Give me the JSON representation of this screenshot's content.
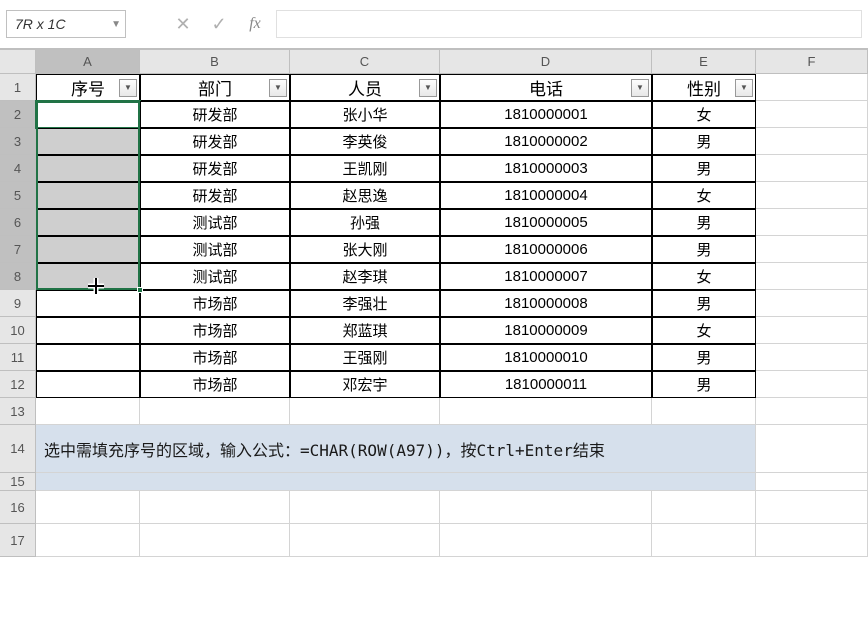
{
  "namebox": "7R x 1C",
  "formula": "",
  "columns": [
    "A",
    "B",
    "C",
    "D",
    "E",
    "F"
  ],
  "row_count": 17,
  "selected_col": "A",
  "selected_rows_start": 2,
  "selected_rows_end": 8,
  "headers": {
    "A": "序号",
    "B": "部门",
    "C": "人员",
    "D": "电话",
    "E": "性别"
  },
  "rows": [
    {
      "B": "研发部",
      "C": "张小华",
      "D": "1810000001",
      "E": "女"
    },
    {
      "B": "研发部",
      "C": "李英俊",
      "D": "1810000002",
      "E": "男"
    },
    {
      "B": "研发部",
      "C": "王凯刚",
      "D": "1810000003",
      "E": "男"
    },
    {
      "B": "研发部",
      "C": "赵思逸",
      "D": "1810000004",
      "E": "女"
    },
    {
      "B": "测试部",
      "C": "孙强",
      "D": "1810000005",
      "E": "男"
    },
    {
      "B": "测试部",
      "C": "张大刚",
      "D": "1810000006",
      "E": "男"
    },
    {
      "B": "测试部",
      "C": "赵李琪",
      "D": "1810000007",
      "E": "女"
    },
    {
      "B": "市场部",
      "C": "李强壮",
      "D": "1810000008",
      "E": "男"
    },
    {
      "B": "市场部",
      "C": "郑蓝琪",
      "D": "1810000009",
      "E": "女"
    },
    {
      "B": "市场部",
      "C": "王强刚",
      "D": "1810000010",
      "E": "男"
    },
    {
      "B": "市场部",
      "C": "邓宏宇",
      "D": "1810000011",
      "E": "男"
    }
  ],
  "note": "选中需填充序号的区域，输入公式：=CHAR(ROW(A97))，按Ctrl+Enter结束"
}
